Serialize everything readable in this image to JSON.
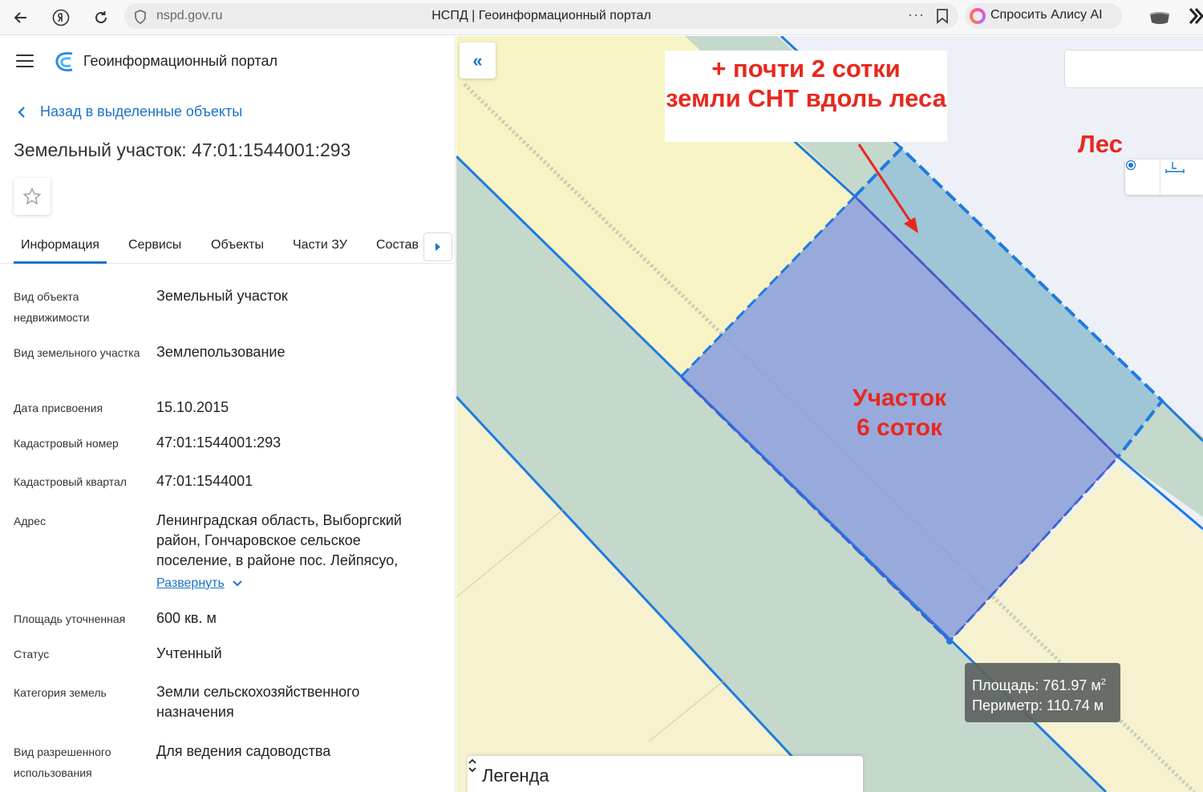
{
  "browser": {
    "url": "nspd.gov.ru",
    "tab_title": "НСПД | Геоинформационный портал",
    "menu_dots": "···",
    "alice_label": "Спросить Алису AI"
  },
  "sidebar": {
    "portal_title": "Геоинформационный портал",
    "back_label": "Назад в выделенные объекты",
    "page_title": "Земельный участок: 47:01:1544001:293",
    "tabs": [
      {
        "label": "Информация",
        "active": true
      },
      {
        "label": "Сервисы"
      },
      {
        "label": "Объекты"
      },
      {
        "label": "Части ЗУ"
      },
      {
        "label": "Состав"
      }
    ],
    "rows": [
      {
        "label": "Вид объекта недвижимости",
        "value": "Земельный участок"
      },
      {
        "label": "Вид земельного участка",
        "value": "Землепользование"
      },
      {
        "label": "Дата присвоения",
        "value": "15.10.2015"
      },
      {
        "label": "Кадастровый номер",
        "value": "47:01:1544001:293"
      },
      {
        "label": "Кадастровый квартал",
        "value": "47:01:1544001"
      },
      {
        "label": "Адрес",
        "value": "Ленинградская область, Выборгский район, Гончаровское сельское поселение, в районе пос. Лейпясуо,"
      },
      {
        "label": "Площадь уточненная",
        "value": "600 кв. м"
      },
      {
        "label": "Статус",
        "value": "Учтенный"
      },
      {
        "label": "Категория земель",
        "value": "Земли сельскохозяйственного назначения"
      },
      {
        "label": "Вид разрешенного использования",
        "value": "Для ведения садоводства"
      }
    ],
    "expand_label": "Развернуть"
  },
  "map": {
    "collapse_icon": "«",
    "annotation_line1": "+ почти 2 сотки",
    "annotation_line2": "земли СНТ вдоль леса",
    "les_label": "Лес",
    "plot_label_line1": "Участок",
    "plot_label_line2": "6 соток",
    "measure_area_prefix": "Площадь: 761.97 м",
    "measure_area_sup": "2",
    "measure_perimeter": "Периметр: 110.74 м",
    "legend_title": "Легенда",
    "colors": {
      "accent": "#1a73c9",
      "annotation_red": "#e8281e",
      "parcel_fill": "#8c9fd8",
      "strip_fill": "#9fc6d6",
      "green_band": "#c4d8cc",
      "yellow_zone": "#f8f3c4",
      "forest_bg": "#eef0f7"
    },
    "icons": [
      "collapse-left-icon",
      "locate-icon",
      "ruler-icon",
      "legend-toggle-icon"
    ]
  }
}
